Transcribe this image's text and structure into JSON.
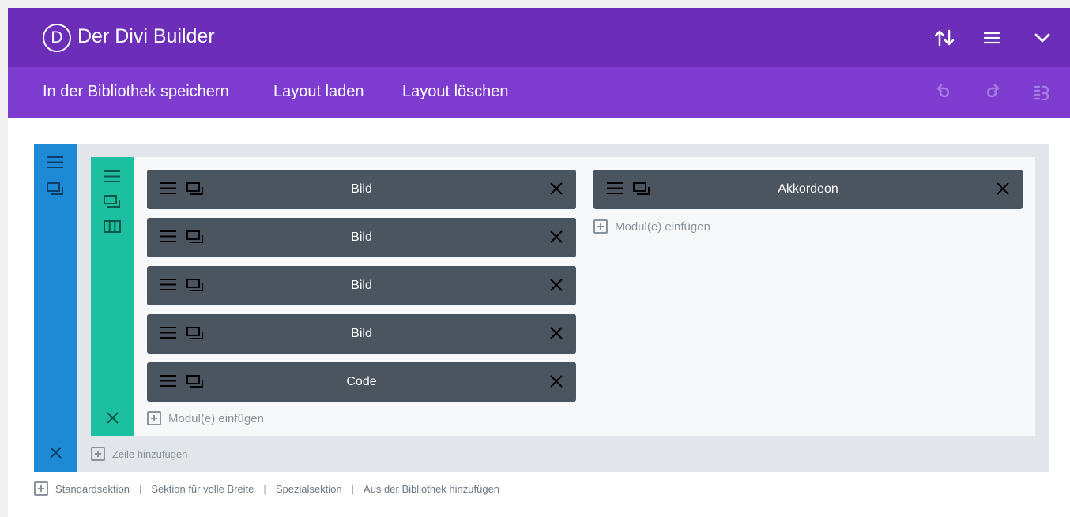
{
  "header": {
    "logo_letter": "D",
    "title": "Der Divi Builder",
    "icons": [
      "sort-arrows-icon",
      "hamburger-menu-icon",
      "chevron-down-icon"
    ],
    "background": "#6c2eb9"
  },
  "toolbar": {
    "save_to_library": "In der Bibliothek speichern",
    "load_layout": "Layout laden",
    "clear_layout": "Layout löschen",
    "icons": [
      "undo-icon",
      "redo-icon",
      "history-icon"
    ],
    "background": "#7e3bd0"
  },
  "section": {
    "bar_color": "#1e8ad6",
    "icons": [
      "section-handle-icon",
      "section-clone-icon",
      "section-delete-icon"
    ],
    "add_row": "Zeile hinzufügen",
    "row": {
      "bar_color": "#1cbfa0",
      "icons": [
        "row-handle-icon",
        "row-clone-icon",
        "row-columns-icon",
        "row-delete-icon"
      ],
      "columns": [
        {
          "modules": [
            {
              "label": "Bild"
            },
            {
              "label": "Bild"
            },
            {
              "label": "Bild"
            },
            {
              "label": "Bild"
            },
            {
              "label": "Code"
            }
          ],
          "add_module": "Modul(e) einfügen"
        },
        {
          "modules": [
            {
              "label": "Akkordeon"
            }
          ],
          "add_module": "Modul(e) einfügen"
        }
      ]
    }
  },
  "footer_links": {
    "standard_section": "Standardsektion",
    "fullwidth_section": "Sektion für volle Breite",
    "special_section": "Spezialsektion",
    "from_library": "Aus der Bibliothek hinzufügen",
    "separator": "|"
  },
  "colors": {
    "module_bg": "#4b5560",
    "section_bg": "#e2e5e9",
    "row_bg": "#f6f8fa"
  }
}
